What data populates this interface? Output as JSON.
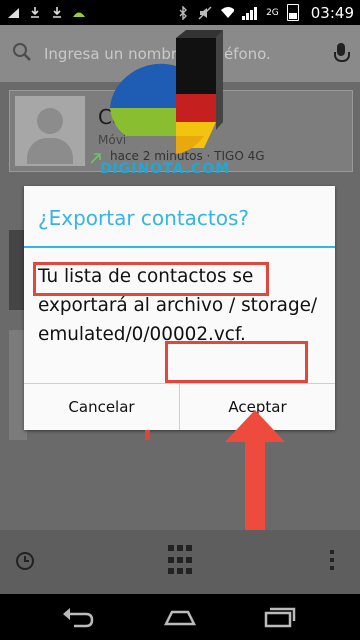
{
  "status_bar": {
    "time": "03:49",
    "network_label": "2G",
    "icons": [
      "signal-icon",
      "download-icon",
      "download-icon",
      "android-icon",
      "bluetooth-icon",
      "mute-icon",
      "wifi-icon",
      "signal-icon",
      "battery-icon"
    ]
  },
  "search": {
    "placeholder": "Ingresa un nombre o teléfono."
  },
  "contact_card": {
    "name": "Ca",
    "type": "Móvi",
    "meta": "hace 2 minutos · TIGO 4G"
  },
  "watermark": {
    "text": "DIGINOTA.COM"
  },
  "dialog": {
    "title": "¿Exportar contactos?",
    "message": "Tu lista de contactos se exportará al archivo / storage/ emulated/0/00002.vcf.",
    "cancel_label": "Cancelar",
    "accept_label": "Aceptar"
  },
  "colors": {
    "accent": "#33b5e5",
    "annotation_red": "#e0483e"
  }
}
